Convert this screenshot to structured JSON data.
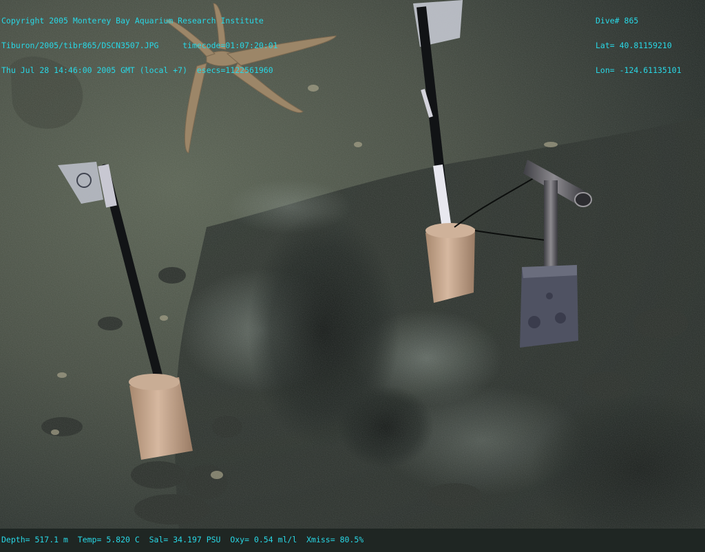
{
  "overlay": {
    "top_left": [
      "Copyright 2005 Monterey Bay Aquarium Research Institute",
      "Tiburon/2005/tibr865/DSCN3507.JPG     timecode=01:07:20:01",
      "Thu Jul 28 14:46:00 2005 GMT (local +7)  esecs=1122561960"
    ],
    "top_right": [
      "Dive# 865",
      "Lat= 40.81159210",
      "Lon= -124.61135101"
    ],
    "bottom": "Depth= 517.1 m  Temp= 5.820 C  Sal= 34.197 PSU  Oxy= 0.54 ml/l  Xmiss= 80.5%"
  },
  "colors": {
    "overlay_text": "#28d8e6",
    "sediment": "#4a5145",
    "shadow": "#1a1f1c",
    "core_tube": "#c9a992",
    "starfish": "#9c8668"
  },
  "scene_objects": [
    "starfish",
    "left-marker-pole",
    "left-core-tube",
    "right-marker-pole",
    "right-core-tube",
    "t-handle-instrument",
    "instrument-box",
    "dark-pit"
  ]
}
